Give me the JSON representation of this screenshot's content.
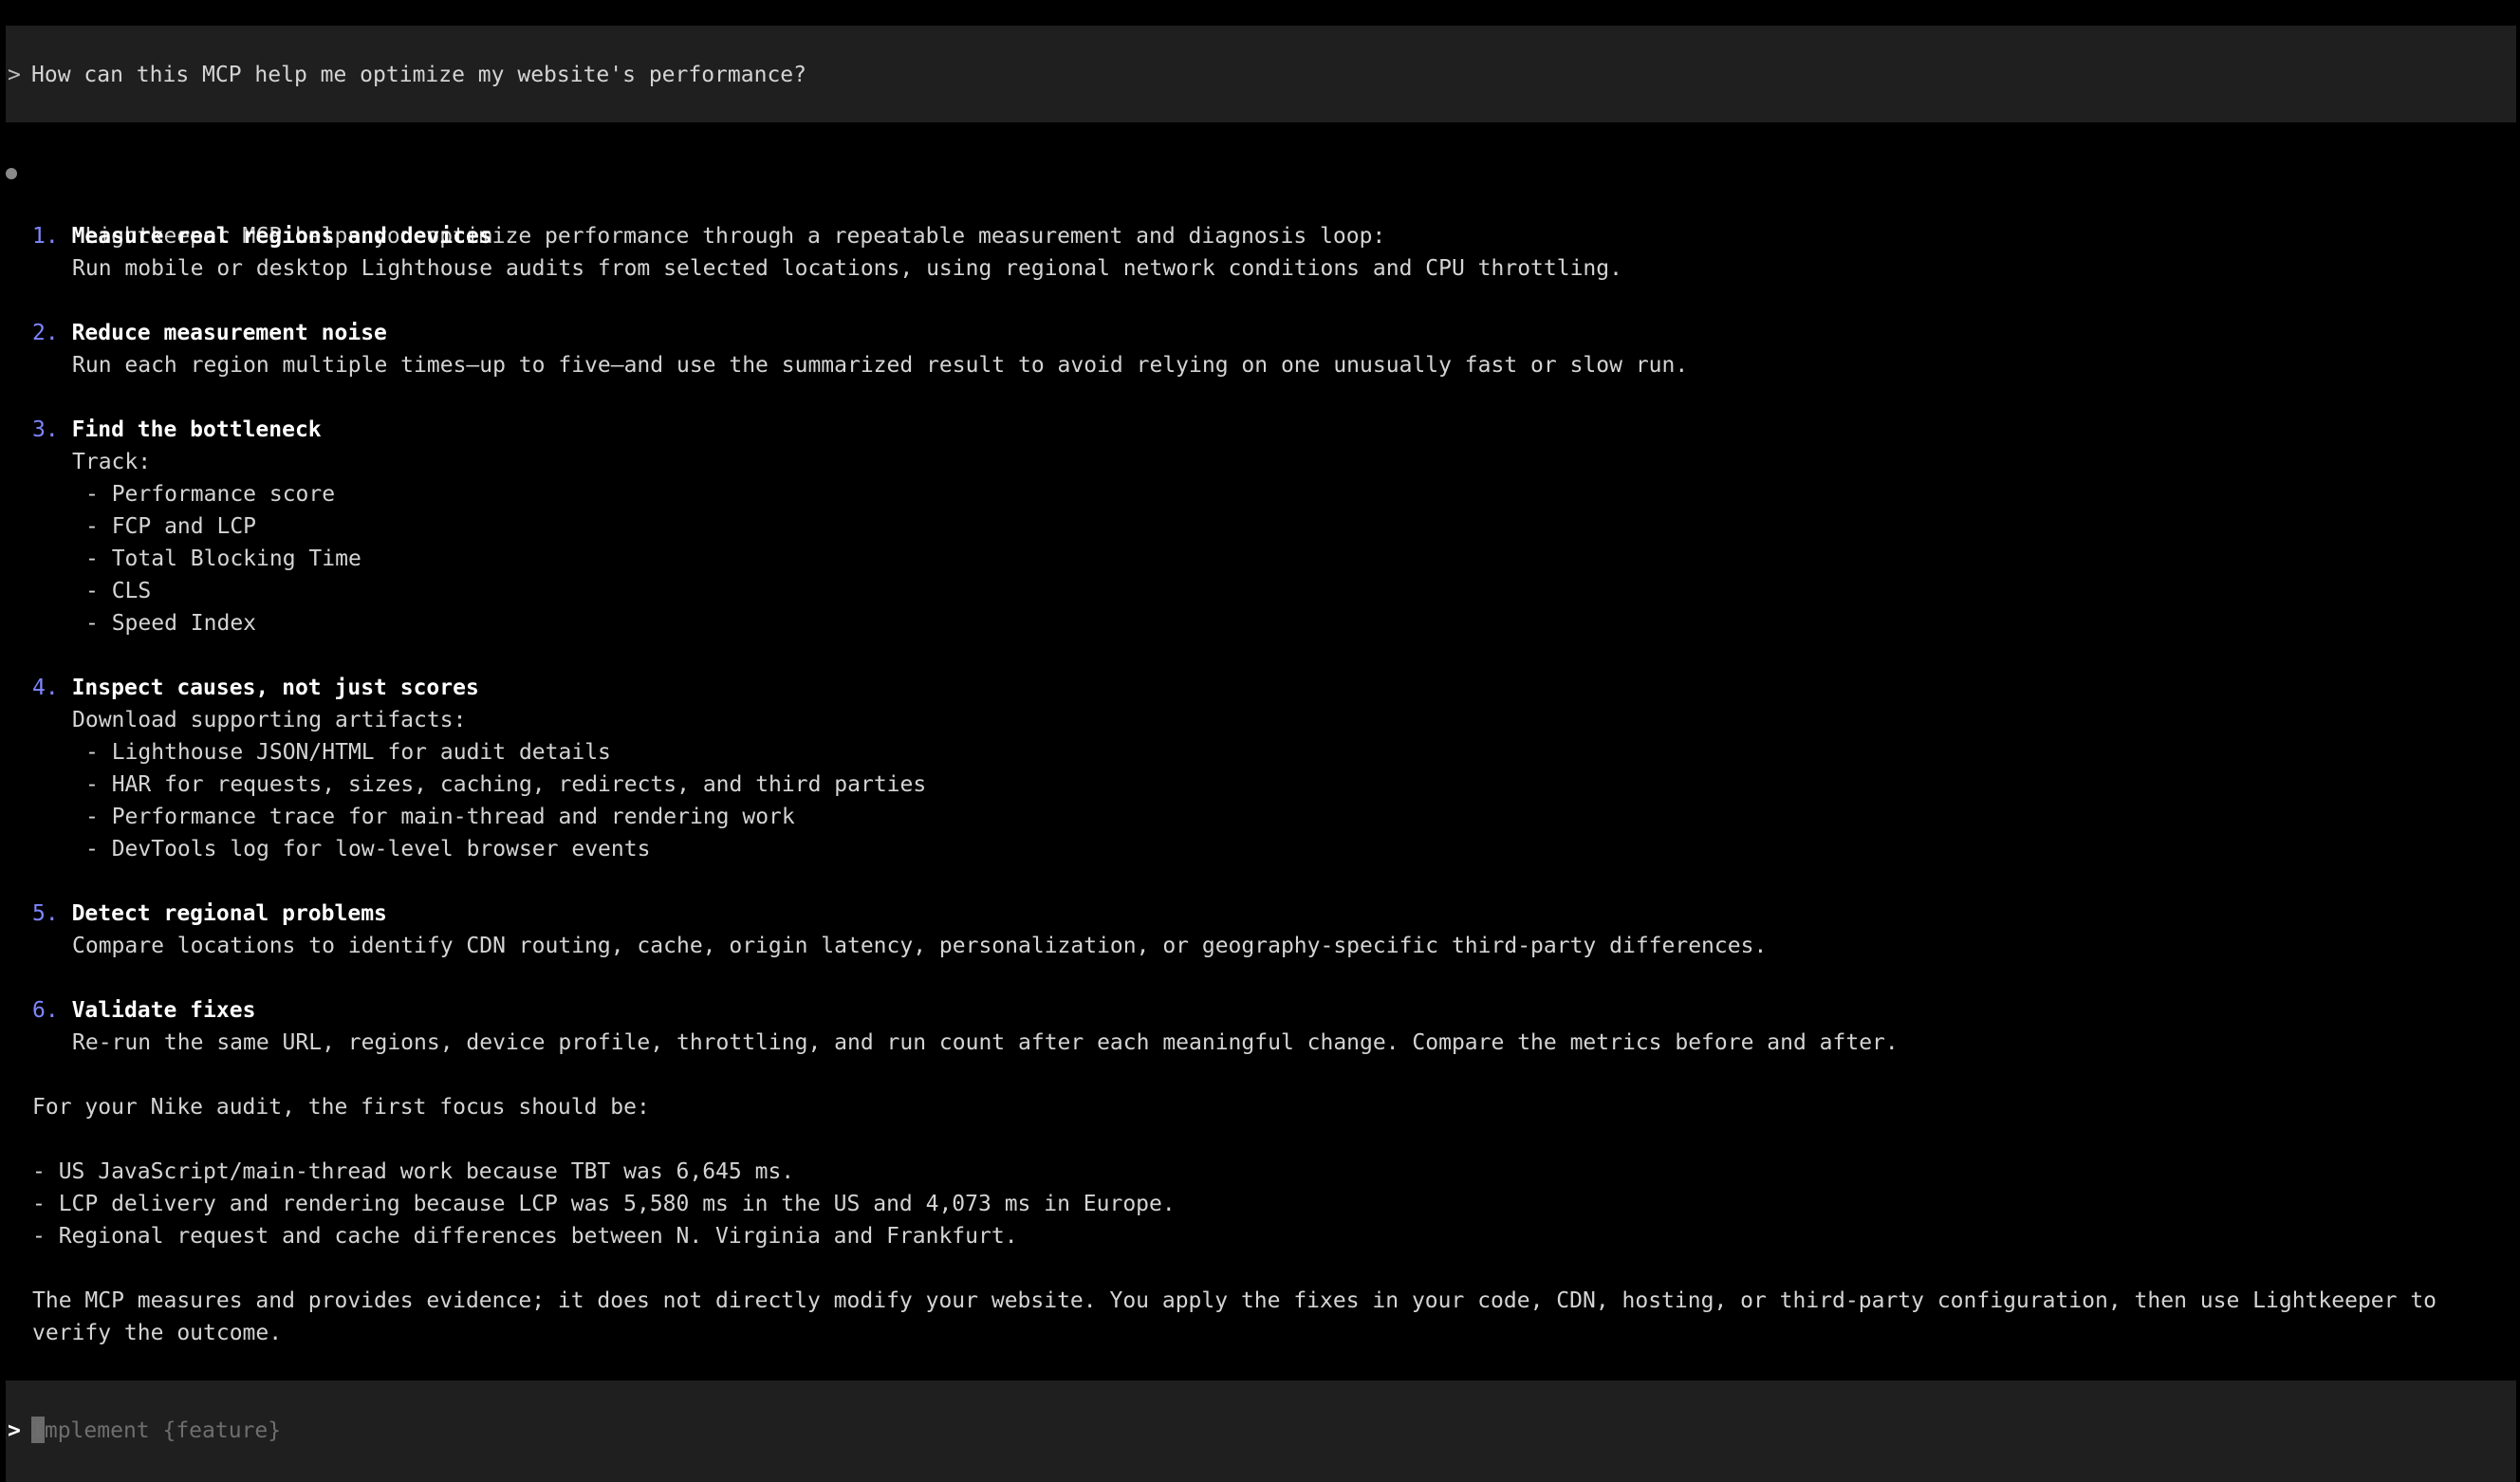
{
  "user_prompt": {
    "chevron": ">",
    "text": "How can this MCP help me optimize my website's performance?"
  },
  "response": {
    "intro": "Lightkeeper MCP helps you optimize performance through a repeatable measurement and diagnosis loop:",
    "steps": [
      {
        "number": "1.",
        "title": "Measure real regions and devices",
        "description": "Run mobile or desktop Lighthouse audits from selected locations, using regional network conditions and CPU throttling."
      },
      {
        "number": "2.",
        "title": "Reduce measurement noise",
        "description": "Run each region multiple times—up to five—and use the summarized result to avoid relying on one unusually fast or slow run."
      },
      {
        "number": "3.",
        "title": "Find the bottleneck",
        "description": "Track:",
        "items": [
          "- Performance score",
          "- FCP and LCP",
          "- Total Blocking Time",
          "- CLS",
          "- Speed Index"
        ]
      },
      {
        "number": "4.",
        "title": "Inspect causes, not just scores",
        "description": "Download supporting artifacts:",
        "items": [
          "- Lighthouse JSON/HTML for audit details",
          "- HAR for requests, sizes, caching, redirects, and third parties",
          "- Performance trace for main-thread and rendering work",
          "- DevTools log for low-level browser events"
        ]
      },
      {
        "number": "5.",
        "title": "Detect regional problems",
        "description": "Compare locations to identify CDN routing, cache, origin latency, personalization, or geography-specific third-party differences."
      },
      {
        "number": "6.",
        "title": "Validate fixes",
        "description": "Re-run the same URL, regions, device profile, throttling, and run count after each meaningful change. Compare the metrics before and after."
      }
    ],
    "focus_intro": "For your Nike audit, the first focus should be:",
    "focus_items": [
      "- US JavaScript/main-thread work because TBT was 6,645 ms.",
      "- LCP delivery and rendering because LCP was 5,580 ms in the US and 4,073 ms in Europe.",
      "- Regional request and cache differences between N. Virginia and Frankfurt."
    ],
    "closing_line1": "The MCP measures and provides evidence; it does not directly modify your website. You apply the fixes in your code, CDN, hosting, or third-party configuration, then use Lightkeeper to",
    "closing_line2": "verify the outcome."
  },
  "input": {
    "chevron": ">",
    "cursor_char": "I",
    "placeholder_rest": "mplement {feature}"
  },
  "colors": {
    "background": "#000000",
    "prompt_block": "#1f1f1f",
    "step_number": "#7f86ff",
    "step_title": "#ffffff",
    "body_text": "#d4d4d4",
    "placeholder": "#6e6e6e"
  }
}
